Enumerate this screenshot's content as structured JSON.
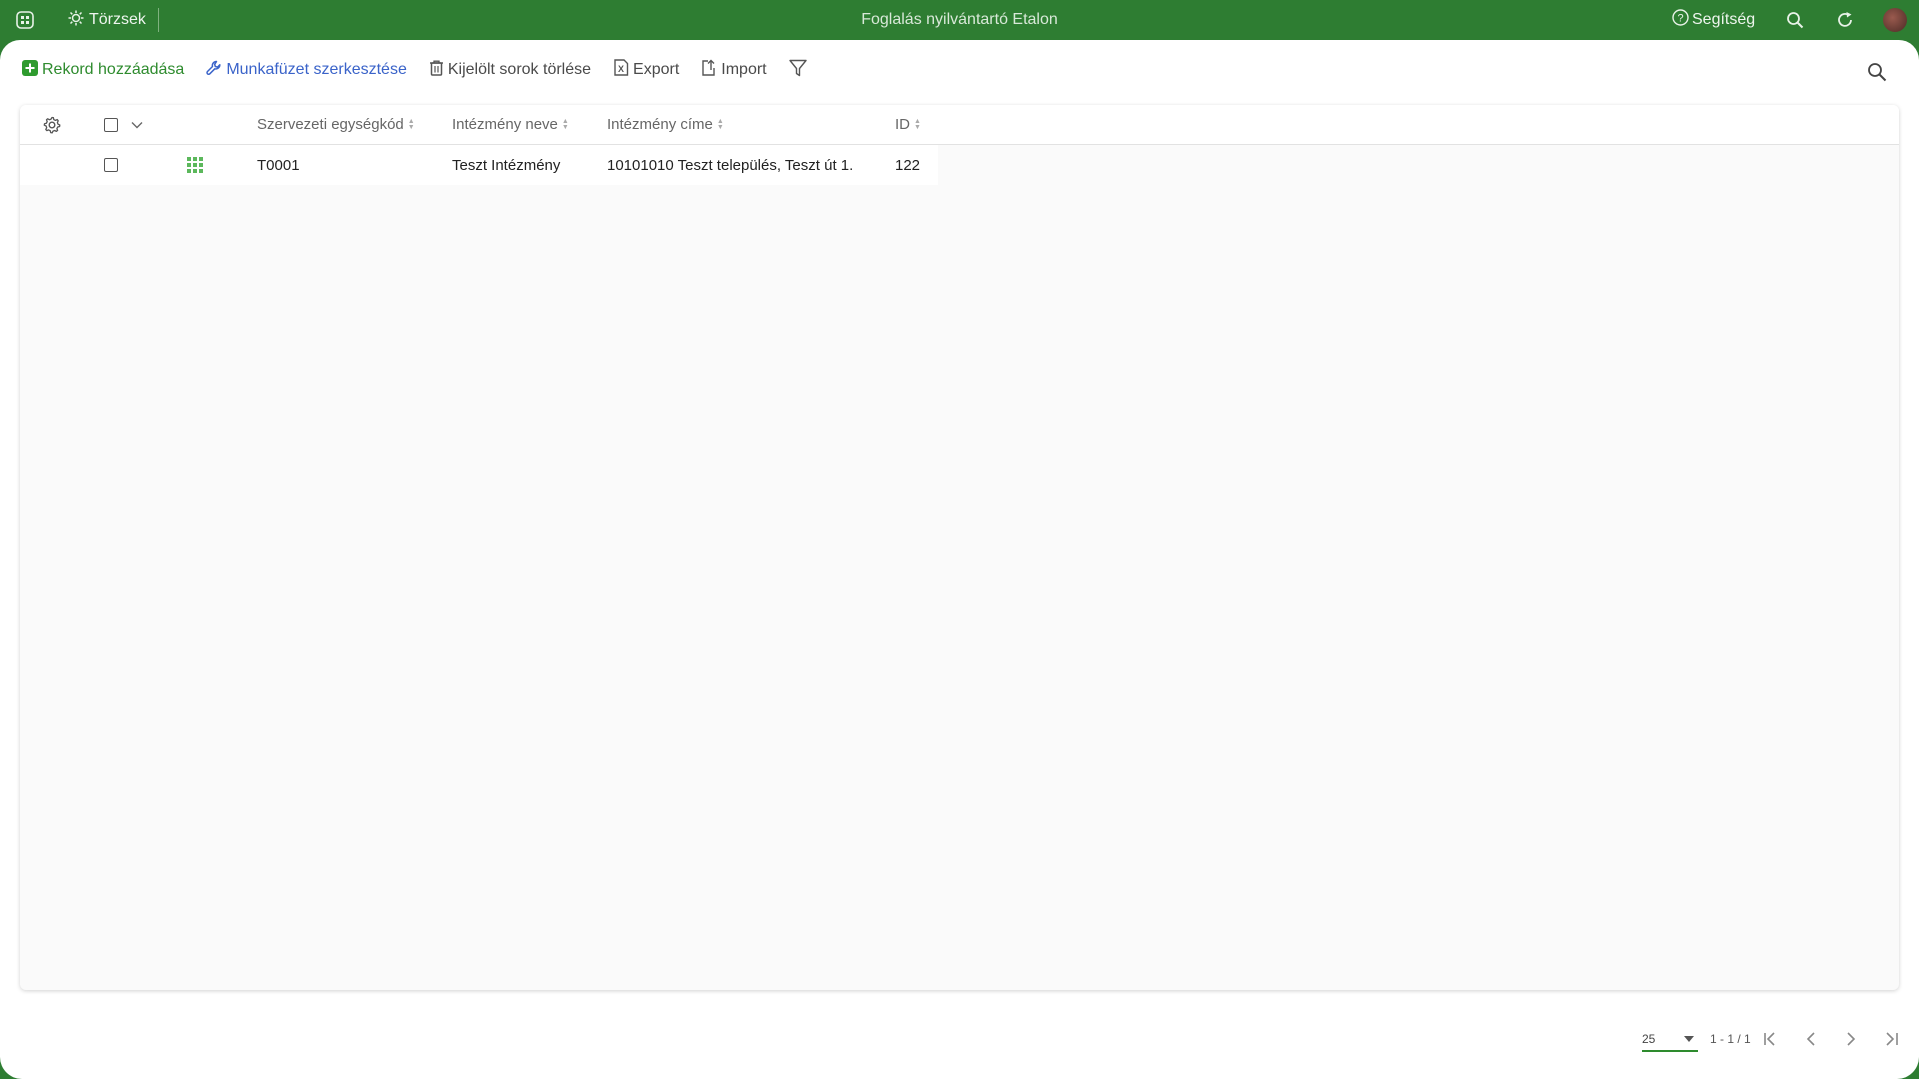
{
  "app": {
    "menu_label": "Törzsek",
    "title": "Foglalás nyilvántartó Etalon",
    "help_label": "Segítség"
  },
  "toolbar": {
    "add_record": "Rekord hozzáadása",
    "edit_workbook": "Munkafüzet szerkesztése",
    "delete_selected": "Kijelölt sorok törlése",
    "export": "Export",
    "import": "Import"
  },
  "table": {
    "columns": [
      "Szervezeti egységkód",
      "Intézmény neve",
      "Intézmény címe",
      "ID"
    ],
    "rows": [
      {
        "code": "T0001",
        "name": "Teszt Intézmény",
        "address": "10101010 Teszt település, Teszt út 1.",
        "id": "122"
      }
    ]
  },
  "pagination": {
    "page_size": "25",
    "range": "1 - 1 / 1"
  },
  "colors": {
    "brand": "#2e7d32",
    "accent_green": "#2e8b2e",
    "accent_blue": "#3a63c9"
  },
  "icons": [
    "apps-grid-icon",
    "sun-gear-icon",
    "help-circle-icon",
    "search-icon",
    "refresh-icon",
    "avatar",
    "plus-square-icon",
    "wrench-icon",
    "trash-icon",
    "excel-icon",
    "import-icon",
    "filter-icon",
    "settings-gear-icon",
    "chevron-down-icon",
    "drag-grid-icon",
    "first-page-icon",
    "prev-page-icon",
    "next-page-icon",
    "last-page-icon"
  ]
}
